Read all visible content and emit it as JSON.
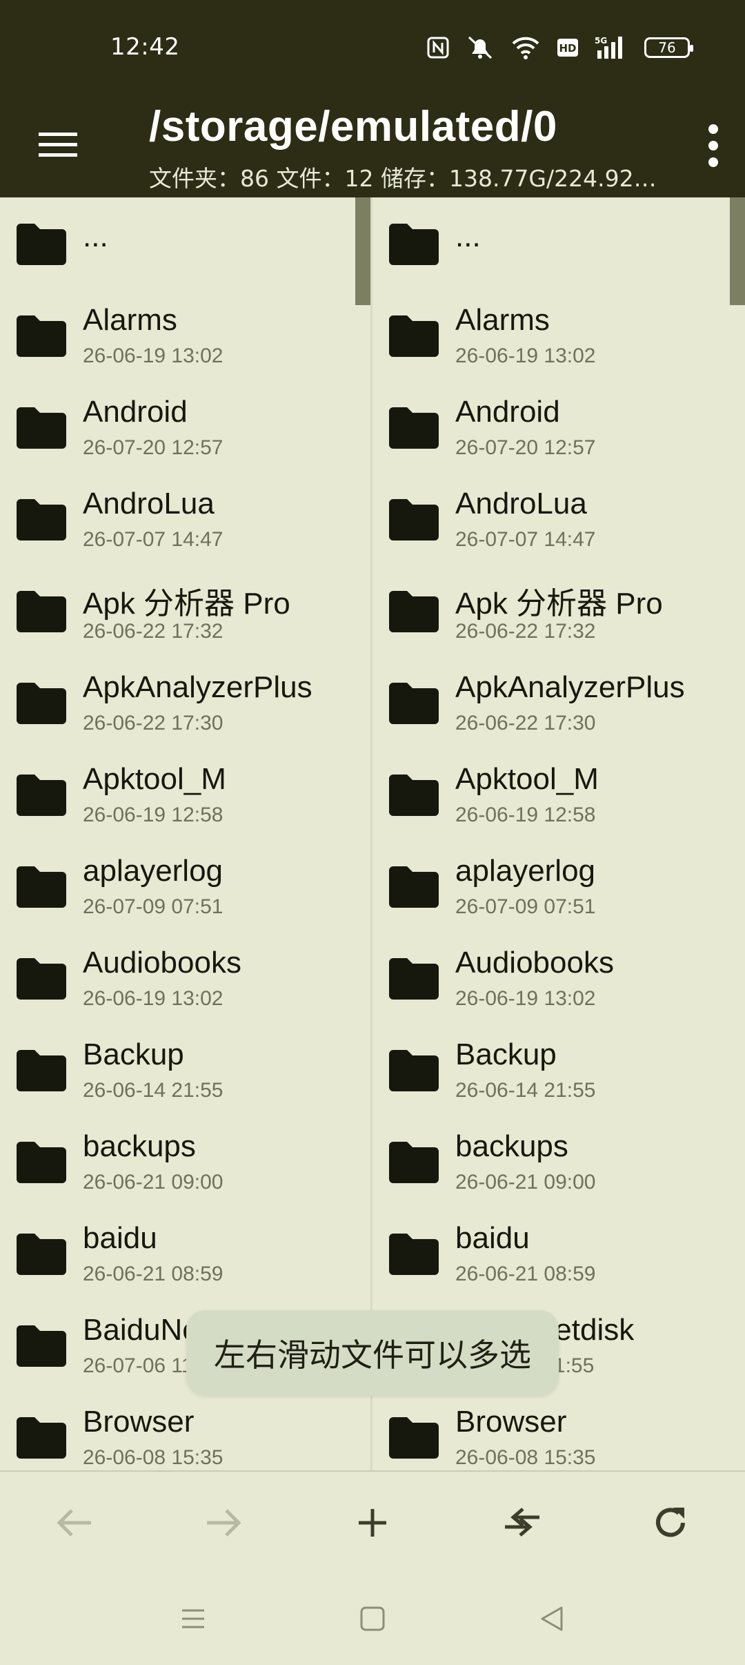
{
  "status": {
    "time": "12:42",
    "battery": "76",
    "icons": [
      "nfc-icon",
      "mute-icon",
      "wifi-icon",
      "hd-icon",
      "signal-5g-icon",
      "battery-icon"
    ]
  },
  "appbar": {
    "path": "/storage/emulated/0",
    "stats": "文件夹：86  文件：12  储存：138.77G/224.92…",
    "menu_icon": "hamburger-menu-icon",
    "overflow_icon": "more-vert-icon"
  },
  "files": [
    {
      "name": "...",
      "date": ""
    },
    {
      "name": "Alarms",
      "date": "26-06-19 13:02"
    },
    {
      "name": "Android",
      "date": "26-07-20 12:57"
    },
    {
      "name": "AndroLua",
      "date": "26-07-07 14:47"
    },
    {
      "name": "Apk 分析器 Pro",
      "date": "26-06-22 17:32"
    },
    {
      "name": "ApkAnalyzerPlus",
      "date": "26-06-22 17:30"
    },
    {
      "name": "Apktool_M",
      "date": "26-06-19 12:58"
    },
    {
      "name": "aplayerlog",
      "date": "26-07-09 07:51"
    },
    {
      "name": "Audiobooks",
      "date": "26-06-19 13:02"
    },
    {
      "name": "Backup",
      "date": "26-06-14 21:55"
    },
    {
      "name": "backups",
      "date": "26-06-21 09:00"
    },
    {
      "name": "baidu",
      "date": "26-06-21 08:59"
    },
    {
      "name": "BaiduNetdisk",
      "date": "26-07-06 11:55"
    },
    {
      "name": "Browser",
      "date": "26-06-08 15:35"
    }
  ],
  "toast": "左右滑动文件可以多选",
  "toolbar": {
    "back_icon": "arrow-left-icon",
    "forward_icon": "arrow-right-icon",
    "add_icon": "plus-icon",
    "swap_icon": "swap-arrows-icon",
    "refresh_icon": "refresh-icon"
  },
  "navbar": {
    "recents_icon": "recents-icon",
    "home_icon": "home-icon",
    "back_icon": "back-triangle-icon"
  },
  "colors": {
    "appbar": "#2c2d14",
    "background": "#e7e9d3",
    "folder": "#17180d",
    "toast": "#d5dcc6"
  }
}
